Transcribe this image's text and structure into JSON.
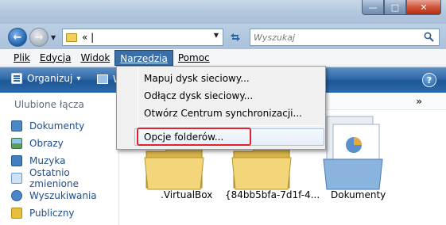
{
  "window": {
    "controls": {
      "minimize": "—",
      "maximize": "□",
      "close": "✕"
    }
  },
  "address": {
    "back_label": "←",
    "forward_label": "→",
    "breadcrumb": "«  |",
    "search_placeholder": "Wyszukaj"
  },
  "menu": {
    "items": [
      "Plik",
      "Edycja",
      "Widok",
      "Narzędzia",
      "Pomoc"
    ],
    "active": "Narzędzia"
  },
  "commandbar": {
    "organize_label": "Organizuj",
    "organize_arrow": "▾",
    "views_label": "W",
    "help_label": "?"
  },
  "dropdown": {
    "items": [
      "Mapuj dysk sieciowy...",
      "Odłącz dysk sieciowy...",
      "Otwórz Centrum synchronizacji...",
      "Opcje folderów..."
    ],
    "highlighted": "Opcje folderów...",
    "highlight_color": "#e0212f"
  },
  "navpane": {
    "header": "Ulubione łącza",
    "items": [
      {
        "label": "Dokumenty",
        "icon": "documents-icon",
        "color": "#4c88c8"
      },
      {
        "label": "Obrazy",
        "icon": "pictures-icon",
        "color": "#5b9f5b"
      },
      {
        "label": "Muzyka",
        "icon": "music-icon",
        "color": "#3f7fc2"
      },
      {
        "label": "Ostatnio zmienione",
        "icon": "recent-icon",
        "color": "#6a9bd0"
      },
      {
        "label": "Wyszukiwania",
        "icon": "searches-icon",
        "color": "#4a86c9"
      },
      {
        "label": "Publiczny",
        "icon": "public-folder-icon",
        "color": "#e8bf3c"
      }
    ]
  },
  "content": {
    "more_chevron": "»",
    "files": [
      {
        "name": ".VirtualBox",
        "icon": "folder-icon"
      },
      {
        "name": "{84bb5bfa-7d1f-4...",
        "icon": "folder-icon"
      },
      {
        "name": "Dokumenty",
        "icon": "documents-folder-icon"
      }
    ]
  },
  "colors": {
    "commandbar": "#2d66a6",
    "menu_active": "#3a6ea5",
    "link": "#1f4c88"
  }
}
